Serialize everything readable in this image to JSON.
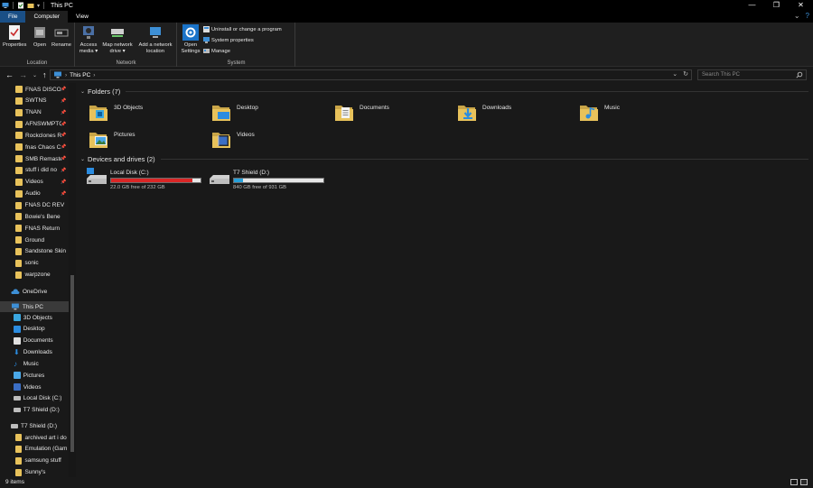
{
  "window": {
    "title": "This PC",
    "controls": {
      "minimize": "—",
      "maximize": "❐",
      "close": "✕"
    }
  },
  "ribbon_tabs": [
    "File",
    "Computer",
    "View"
  ],
  "ribbon": {
    "location": {
      "label": "Location",
      "buttons": [
        "Properties",
        "Open",
        "Rename"
      ]
    },
    "network": {
      "label": "Network",
      "access_media": [
        "Access",
        "media ▾"
      ],
      "map_network": [
        "Map network",
        "drive ▾"
      ],
      "add_network": [
        "Add a network",
        "location"
      ]
    },
    "system": {
      "label": "System",
      "open_settings": [
        "Open",
        "Settings"
      ],
      "items": [
        "Uninstall or change a program",
        "System properties",
        "Manage"
      ]
    }
  },
  "address": {
    "crumb": "This PC",
    "search_placeholder": "Search This PC"
  },
  "navpane": {
    "quick_access": [
      {
        "label": "FNAS DISCOR",
        "pinned": true
      },
      {
        "label": "SWTNS",
        "pinned": true
      },
      {
        "label": "TNAN",
        "pinned": true
      },
      {
        "label": "AFNSWMPTC",
        "pinned": true
      },
      {
        "label": "Rockclones R",
        "pinned": true
      },
      {
        "label": "fnas Chaos C",
        "pinned": true
      },
      {
        "label": "SMB Remaste",
        "pinned": true
      },
      {
        "label": "stuff i did no",
        "pinned": true
      },
      {
        "label": "Videos",
        "pinned": true
      },
      {
        "label": "Audio",
        "pinned": true
      },
      {
        "label": "FNAS DC REV",
        "pinned": false
      },
      {
        "label": "Bowie's Bene",
        "pinned": false
      },
      {
        "label": "FNAS Return",
        "pinned": false
      },
      {
        "label": "Ground",
        "pinned": false
      },
      {
        "label": "Sandstone Skin",
        "pinned": false
      },
      {
        "label": "sonic",
        "pinned": false
      },
      {
        "label": "warpzone",
        "pinned": false
      }
    ],
    "onedrive": "OneDrive",
    "this_pc": "This PC",
    "this_pc_items": [
      "3D Objects",
      "Desktop",
      "Documents",
      "Downloads",
      "Music",
      "Pictures",
      "Videos",
      "Local Disk (C:)",
      "T7 Shield (D:)"
    ],
    "t7": "T7 Shield (D:)",
    "t7_items": [
      "archived art i do",
      "Emulation (Gam",
      "samsung stuff",
      "Sunny's"
    ]
  },
  "content": {
    "folders_header": "Folders (7)",
    "folders": [
      "3D Objects",
      "Desktop",
      "Documents",
      "Downloads",
      "Music",
      "Pictures",
      "Videos"
    ],
    "drives_header": "Devices and drives (2)",
    "drives": [
      {
        "name": "Local Disk (C:)",
        "free": "22.0 GB free of 232 GB",
        "used_fraction": 0.905,
        "bar_color": "#da2626"
      },
      {
        "name": "T7 Shield (D:)",
        "free": "840 GB free of 931 GB",
        "used_fraction": 0.098,
        "bar_color": "#26a0da"
      }
    ]
  },
  "status": {
    "items": "9 items"
  }
}
